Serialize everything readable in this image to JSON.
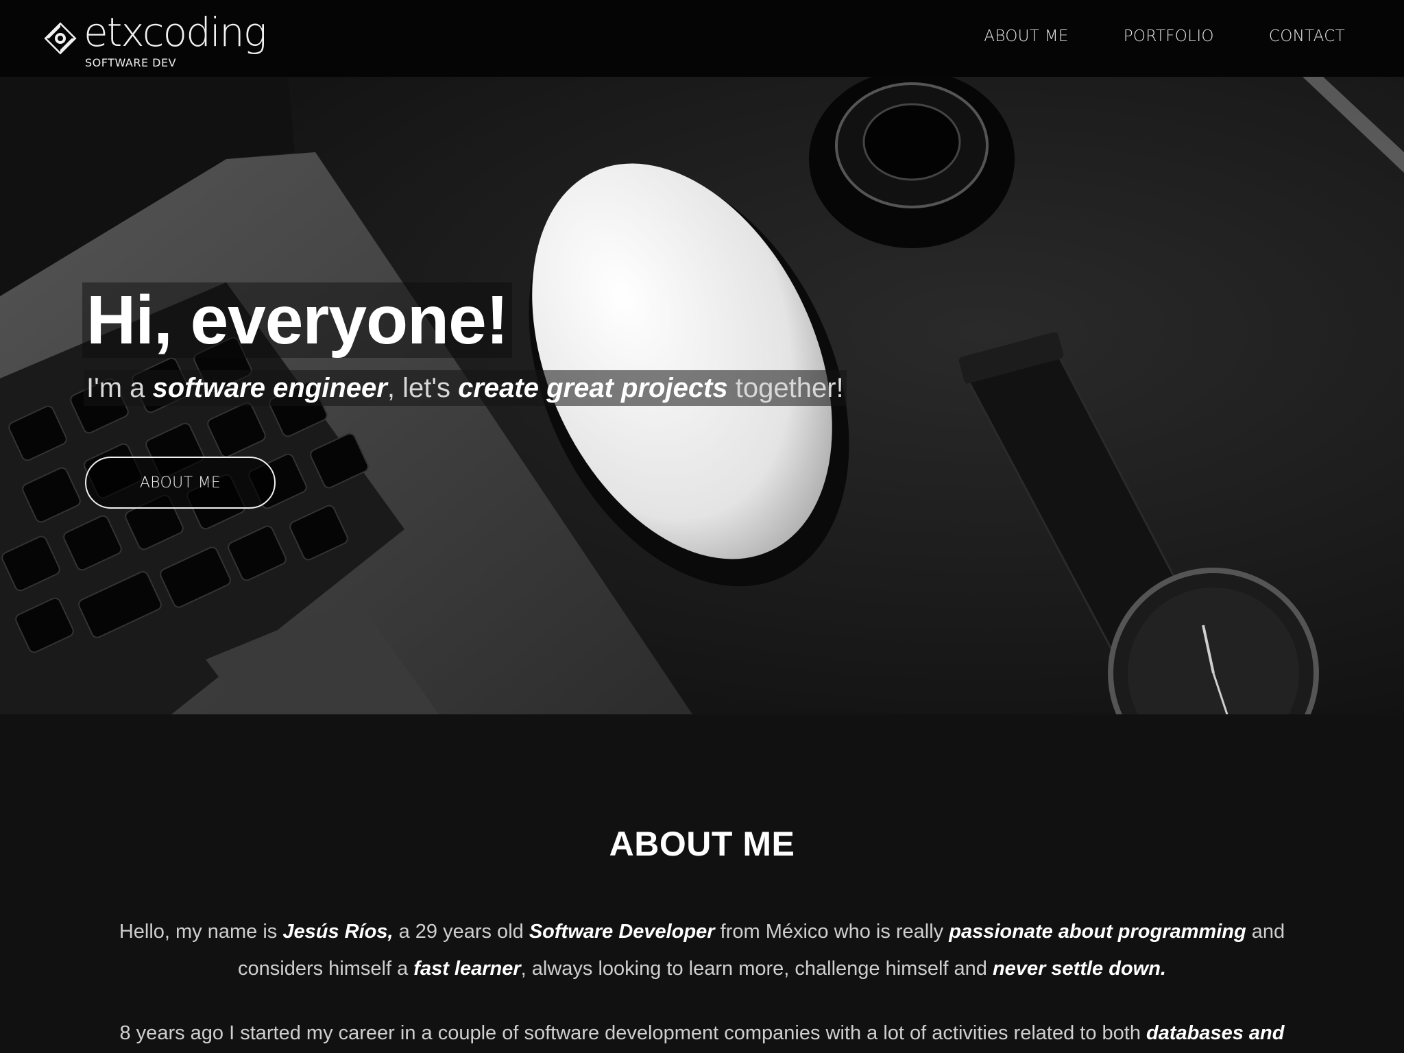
{
  "brand": {
    "name": "etxcoding",
    "tagline": "SOFTWARE DEV",
    "logo_icon": "diamond-eye-logo-icon"
  },
  "nav": {
    "items": [
      {
        "label": "ABOUT ME"
      },
      {
        "label": "PORTFOLIO"
      },
      {
        "label": "CONTACT"
      }
    ]
  },
  "hero": {
    "title": "Hi, everyone!",
    "subtitle": {
      "p1": "I'm a ",
      "b1": "software engineer",
      "p2": ", let's ",
      "b2": "create great projects",
      "p3": " together!"
    },
    "button_label": "ABOUT ME"
  },
  "about": {
    "title": "ABOUT ME",
    "paragraph1": {
      "t1": "Hello, my name is ",
      "b1": "Jesús Ríos,",
      "t2": " a 29 years old ",
      "b2": "Software Developer",
      "t3": " from México who is really ",
      "b3": "passionate about programming",
      "t4": " and considers himself a ",
      "b4": "fast learner",
      "t5": ", always looking to learn more, challenge himself and ",
      "b5": "never settle down."
    },
    "paragraph2": {
      "t1": "8 years ago I started my career in a couple of software development companies with a lot of activities related to both ",
      "b1": "databases and"
    }
  },
  "colors": {
    "nav_bg": "#050505",
    "page_bg": "#111111",
    "text_primary": "#ffffff",
    "text_muted": "#cfcfcf"
  }
}
